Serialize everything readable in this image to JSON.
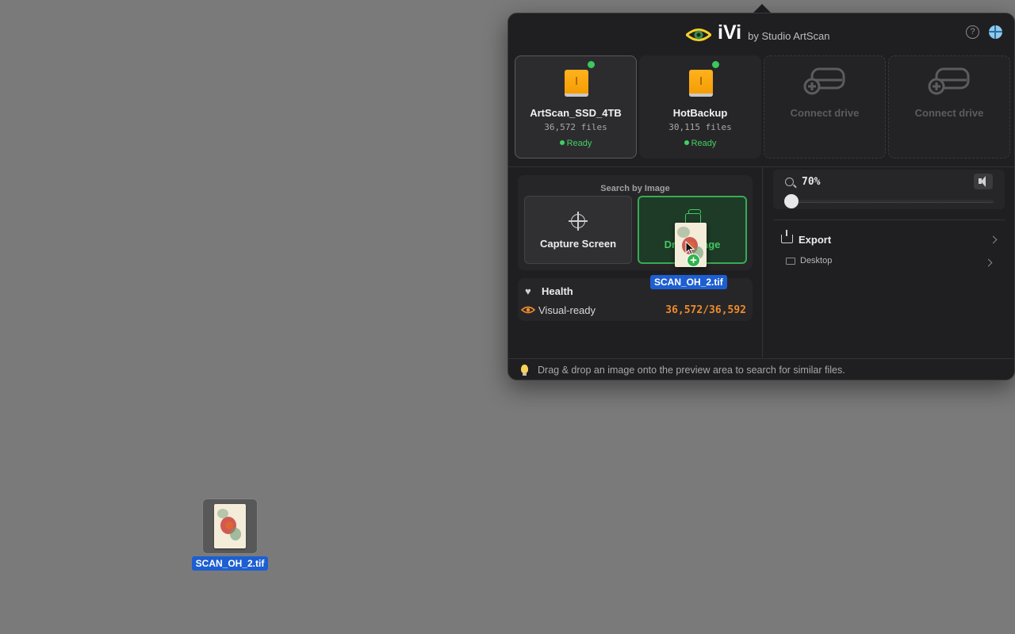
{
  "app": {
    "name": "iVi",
    "by_line": "by Studio ArtScan",
    "help_glyph": "?"
  },
  "drives": [
    {
      "name": "ArtScan_SSD_4TB",
      "files": "36,572 files",
      "status": "Ready",
      "state": "active"
    },
    {
      "name": "HotBackup",
      "files": "30,115 files",
      "status": "Ready",
      "state": "normal"
    },
    {
      "label": "Connect drive",
      "state": "empty"
    },
    {
      "label": "Connect drive",
      "state": "empty"
    }
  ],
  "search": {
    "title": "Search by Image",
    "capture_label": "Capture Screen",
    "drag_label": "Drag Image"
  },
  "health": {
    "title": "Health",
    "visual_label": "Visual-ready",
    "visual_count": "36,572/36,592"
  },
  "zoom": {
    "value": "70%",
    "level_fraction": 0.0
  },
  "export": {
    "label": "Export",
    "destination": "Desktop"
  },
  "footer": {
    "tip": "Drag & drop an image onto the preview area to search for similar files."
  },
  "dragging_file": {
    "name": "SCAN_OH_2.tif",
    "badge": "+"
  },
  "desktop_file": {
    "name": "SCAN_OH_2.tif"
  },
  "colors": {
    "accent_green": "#43c865",
    "ready_green": "#42d064",
    "count_orange": "#f08a2b",
    "drive_orange": "#f49a00",
    "selection_blue": "#1d5fd1",
    "logo_yellow": "#f5d02a"
  }
}
